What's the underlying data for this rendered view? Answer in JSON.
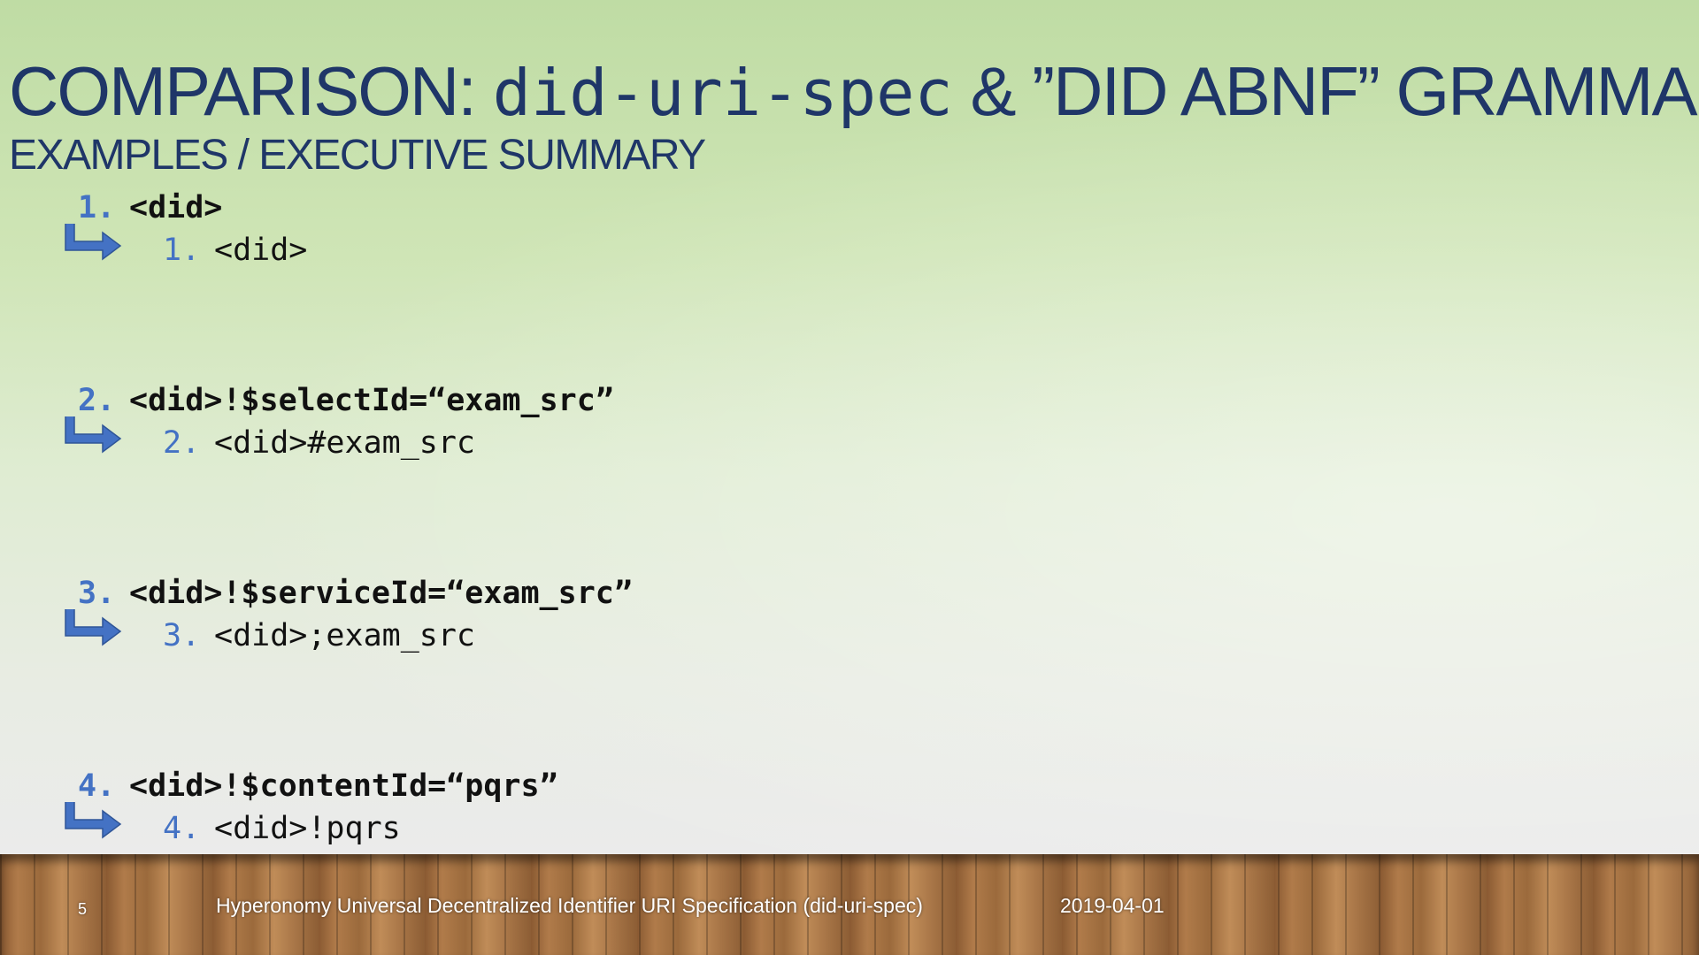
{
  "slide": {
    "title_part1": "COMPARISON: ",
    "title_code": "did-uri-spec",
    "title_part2": " & ”DID ABNF” GRAMMARS",
    "subtitle": "EXAMPLES / EXECUTIVE SUMMARY"
  },
  "examples": [
    {
      "num": "1.",
      "main": "<did>",
      "sub_num": "1.",
      "sub": "<did>"
    },
    {
      "num": "2.",
      "main": "<did>!$selectId=“exam_src”",
      "sub_num": "2.",
      "sub": "<did>#exam_src"
    },
    {
      "num": "3.",
      "main": "<did>!$serviceId=“exam_src”",
      "sub_num": "3.",
      "sub": "<did>;exam_src"
    },
    {
      "num": "4.",
      "main": "<did>!$contentId=“pqrs”",
      "sub_num": "4.",
      "sub": "<did>!pqrs"
    }
  ],
  "footer": {
    "page_number": "5",
    "text": "Hyperonomy Universal Decentralized Identifier URI Specification (did-uri-spec)",
    "date": "2019-04-01"
  },
  "colors": {
    "title": "#1f3668",
    "number_accent": "#4472c4",
    "arrow": "#4472c4"
  },
  "icons": {
    "arrow": "bent-arrow-right-icon"
  }
}
